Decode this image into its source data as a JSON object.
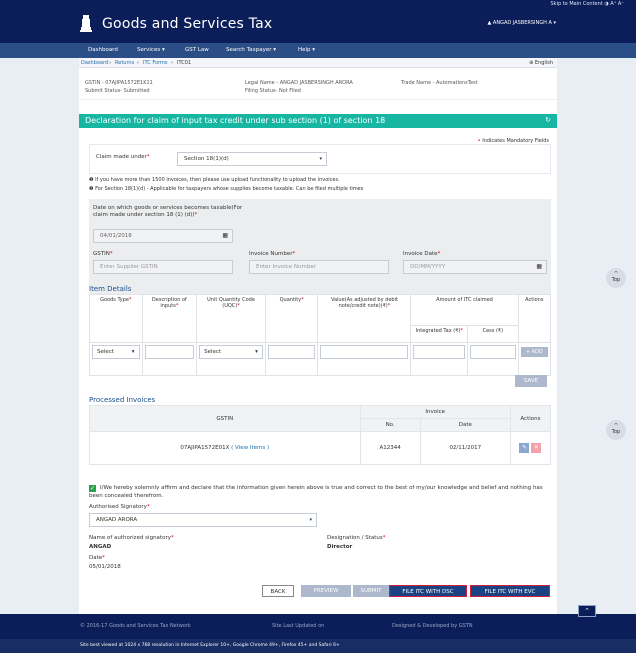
{
  "topstrip": {
    "skip_text": "Skip to Main Content   ◑   A⁺   A⁻"
  },
  "header": {
    "brand": "Goods and Services Tax",
    "user": "▲ ANGAD JASBERSINGH A ▾"
  },
  "nav": [
    {
      "label": "Dashboard"
    },
    {
      "label": "Services ▾"
    },
    {
      "label": "GST Law"
    },
    {
      "label": "Search Taxpayer ▾"
    },
    {
      "label": "Help ▾"
    }
  ],
  "breadcrumb": {
    "dashboard": "Dashboard",
    "sep": "›",
    "returns": "Returns",
    "itcforms": "ITC Forms",
    "current": "ITC01",
    "lang": "⊕ English"
  },
  "info": {
    "gstin": "GSTIN - 07AJIPA1572E1K11",
    "legal": "Legal Name - ANGAD JASBERSINGH ARORA",
    "trade": "Trade Name - AutomationsTest",
    "submit": "Submit Status- Submitted",
    "filing": "Filing Status- Not Filed"
  },
  "section": {
    "title": "Declaration for claim of input tax credit under sub section (1) of section 18",
    "refresh": "↻"
  },
  "mandatory": "Indicates Mandatory Fields",
  "claim": {
    "label": "Claim made under",
    "value": "Section 18(1)(d)"
  },
  "notes": {
    "n1": "If you have more than 1500 invoices, then please use upload functionality to upload the invoices.",
    "n2": "For Section 18(1)(d) - Applicable for taxpayers whose supplies become taxable. Can be filed multiple times"
  },
  "form": {
    "date_label": "Date on which goods or services becomes taxable(For claim made under section 18 (1) (d))",
    "date_value": "04/01/2018",
    "gstin_label": "GSTIN",
    "gstin_placeholder": "Enter Supplier GSTIN",
    "inv_no_label": "Invoice Number",
    "inv_no_placeholder": "Enter Invoice Number",
    "inv_date_label": "Invoice Date",
    "inv_date_placeholder": "DD/MM/YYYY"
  },
  "item_details": {
    "title": "Item Details",
    "headers": {
      "goods_type": "Goods Type",
      "desc": "Description of inputs",
      "uqc": "Unit Quantity Code (UQC)",
      "qty": "Quantity",
      "value": "Value(As adjusted by debit note/credit note)(₹)",
      "itc": "Amount of ITC claimed",
      "igst": "Integrated Tax (₹)",
      "cess": "Cess (₹)",
      "actions": "Actions"
    },
    "select_label": "Select",
    "add_label": "+ ADD",
    "save_label": "SAVE"
  },
  "processed": {
    "title": "Processed Invoices",
    "headers": {
      "gstin": "GSTIN",
      "invoice": "Invoice",
      "actions": "Actions",
      "no": "No.",
      "date": "Date"
    },
    "rows": [
      {
        "gstin": "07AJIPA1572E01X",
        "view": "( View Items )",
        "no": "A12344",
        "date": "02/11/2017"
      }
    ]
  },
  "declaration": {
    "text": "I/We hereby solemnly affirm and declare that the information given herein above is true and correct to the best of my/our knowledge and belief and nothing has been concealed therefrom.",
    "auth_label": "Authorised Signatory",
    "auth_value": "ANGAD ARORA",
    "name_label": "Name of authorized signatory",
    "name_value": "ANGAD",
    "desig_label": "Designation / Status",
    "desig_value": "Director",
    "date_label": "Date",
    "date_value": "05/01/2018"
  },
  "buttons": {
    "back": "BACK",
    "preview": "PREVIEW",
    "submit": "SUBMIT",
    "dsc": "FILE ITC WITH DSC",
    "evc": "FILE ITC WITH EVC"
  },
  "footer": {
    "copy": "© 2016-17 Goods and Services Tax Network",
    "updated": "Site Last Updated on",
    "designed": "Designed & Developed by GSTN",
    "best": "Site best viewed at 1024 x 768 resolution in Internet Explorer 10+, Google Chrome 49+, Firefox 45+ and Safari 6+"
  },
  "top_label": "Top"
}
